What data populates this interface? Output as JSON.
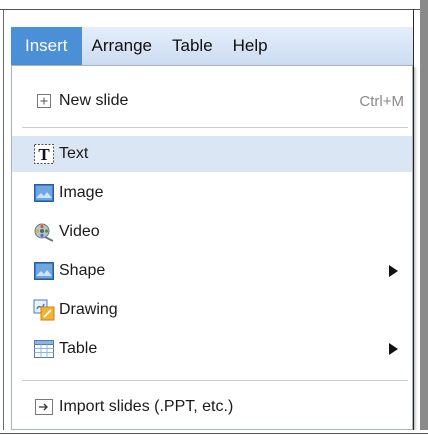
{
  "menubar": {
    "items": [
      {
        "label": "Insert"
      },
      {
        "label": "Arrange"
      },
      {
        "label": "Table"
      },
      {
        "label": "Help"
      }
    ]
  },
  "insert_menu": {
    "new_slide": {
      "label": "New slide",
      "shortcut": "Ctrl+M"
    },
    "text": {
      "label": "Text"
    },
    "image": {
      "label": "Image"
    },
    "video": {
      "label": "Video"
    },
    "shape": {
      "label": "Shape"
    },
    "drawing": {
      "label": "Drawing"
    },
    "table": {
      "label": "Table"
    },
    "import": {
      "label": "Import slides (.PPT, etc.)"
    }
  },
  "icons": {
    "new_slide": "plus-box-icon",
    "text": "text-box-icon",
    "image": "image-icon",
    "video": "film-reel-icon",
    "shape": "image-icon",
    "drawing": "drawing-icon",
    "table": "table-icon",
    "import": "import-arrow-icon"
  },
  "colors": {
    "menubar_active": "#4b8fd6",
    "highlight": "#dbe6f4"
  }
}
